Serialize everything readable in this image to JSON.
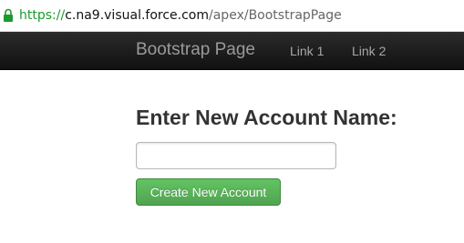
{
  "browser": {
    "url_scheme": "https://",
    "url_host": "c.na9.visual.force.com",
    "url_path": "/apex/BootstrapPage",
    "lock_color": "#1a9a2e"
  },
  "navbar": {
    "brand": "Bootstrap Page",
    "links": [
      {
        "label": "Link 1"
      },
      {
        "label": "Link 2"
      }
    ]
  },
  "main": {
    "heading": "Enter New Account Name:",
    "account_name_input": {
      "value": "",
      "placeholder": ""
    },
    "create_button_label": "Create New Account",
    "button_color": "#5bb75b"
  }
}
